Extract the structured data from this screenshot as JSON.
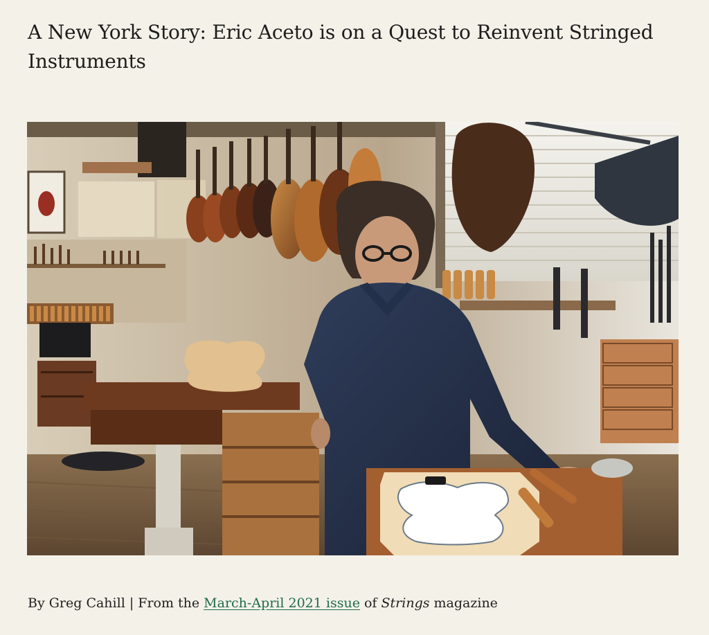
{
  "article": {
    "title": "A New York Story: Eric Aceto is on a Quest to Reinvent Stringed Instruments",
    "image_alt": "Eric Aceto standing in his instrument workshop",
    "byline": {
      "prefix": "By Greg Cahill | From the ",
      "issue_link": "March-April 2021 issue",
      "of_text": " of ",
      "magazine": "Strings",
      "suffix": " magazine"
    }
  },
  "colors": {
    "link": "#1f6b4a",
    "background": "#f4f1e9",
    "text": "#1c1c1c"
  }
}
